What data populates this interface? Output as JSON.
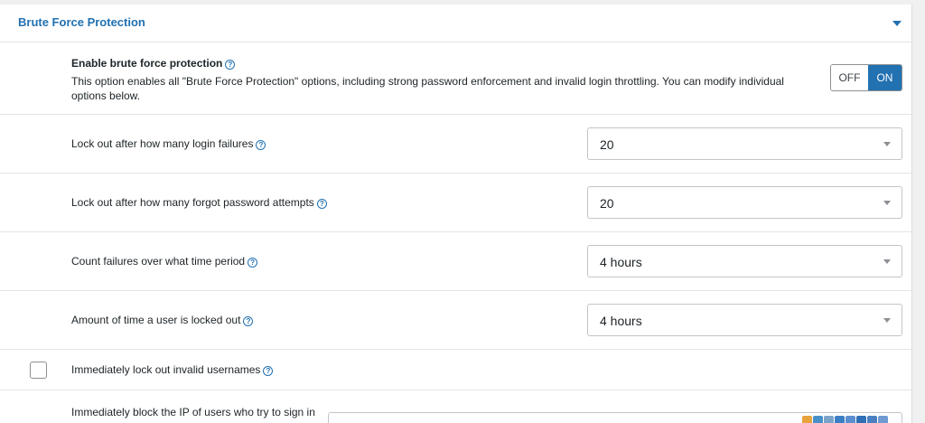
{
  "section": {
    "title": "Brute Force Protection"
  },
  "enable": {
    "title": "Enable brute force protection",
    "description": "This option enables all \"Brute Force Protection\" options, including strong password enforcement and invalid login throttling. You can modify individual options below.",
    "toggle": {
      "off_label": "OFF",
      "on_label": "ON",
      "state": "on"
    }
  },
  "settings": [
    {
      "label": "Lock out after how many login failures",
      "value": "20"
    },
    {
      "label": "Lock out after how many forgot password attempts",
      "value": "20"
    },
    {
      "label": "Count failures over what time period",
      "value": "4 hours"
    },
    {
      "label": "Amount of time a user is locked out",
      "value": "4 hours"
    }
  ],
  "invalid_usernames": {
    "label": "Immediately lock out invalid usernames",
    "checked": false
  },
  "block_ip": {
    "label": "Immediately block the IP of users who try to sign in"
  },
  "help_glyph": "?",
  "colors": {
    "accent": "#2271b1",
    "border": "#e2e4e7",
    "text": "#1d2327"
  }
}
